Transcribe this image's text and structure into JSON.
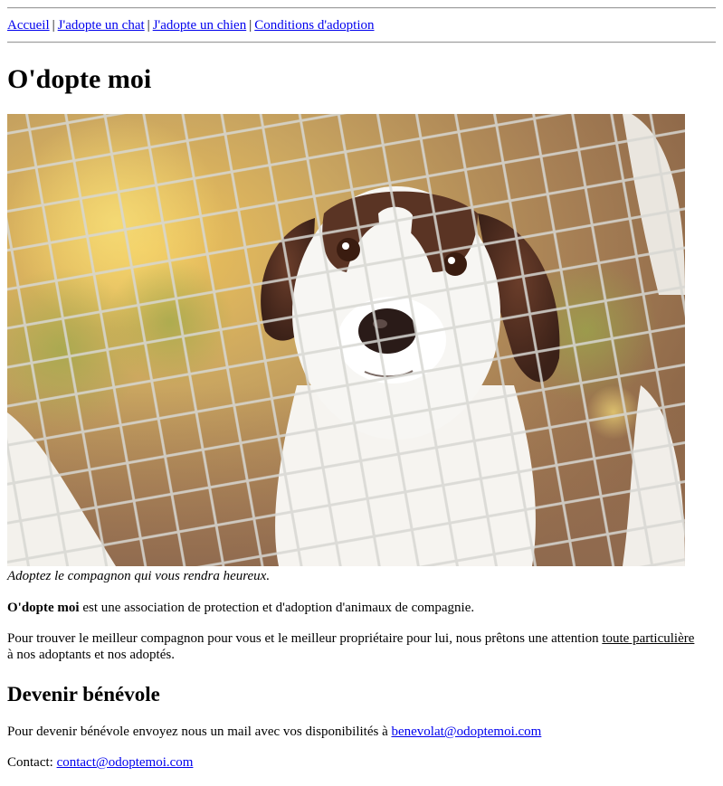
{
  "nav": {
    "links": [
      {
        "label": "Accueil"
      },
      {
        "label": "J'adopte un chat"
      },
      {
        "label": "J'adopte un chien"
      },
      {
        "label": "Conditions d'adoption"
      }
    ],
    "separator": "|"
  },
  "page_title": "O'dopte moi",
  "figure": {
    "image_subject": "puppy behind chain-link fence",
    "caption": "Adoptez le compagnon qui vous rendra heureux."
  },
  "intro": {
    "brand": "O'dopte moi",
    "text": " est une association de protection et d'adoption d'animaux de compagnie."
  },
  "mission": {
    "before": "Pour trouver le meilleur compagnon pour vous et le meilleur propriétaire pour lui, nous prêtons une attention ",
    "emphasis": "toute particulière",
    "after": " à nos adoptants et nos adoptés."
  },
  "volunteer": {
    "heading": "Devenir bénévole",
    "text": "Pour devenir bénévole envoyez nous un mail avec vos disponibilités à ",
    "email": "benevolat@odoptemoi.com"
  },
  "contact": {
    "label": "Contact: ",
    "email": "contact@odoptemoi.com"
  },
  "colors": {
    "link": "#0000ee",
    "rule": "#9a9a9a",
    "text": "#000000"
  }
}
